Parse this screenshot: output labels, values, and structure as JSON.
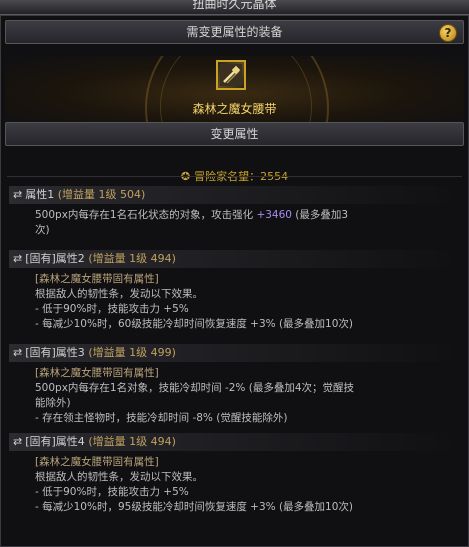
{
  "window_title": "扭曲时久元晶体",
  "header": {
    "equip_section": "需变更属性的装备",
    "help_icon": "?",
    "change_section": "变更属性"
  },
  "item": {
    "name": "森林之魔女腰带",
    "icon": "belt-item-icon"
  },
  "fame": {
    "label": "冒险家名望：",
    "value": "2554"
  },
  "attributes": [
    {
      "title": "属性1",
      "level": "(增益量 1级 504)",
      "lines": [
        {
          "text": "500px内每存在1名石化状态的对象，攻击强化 ",
          "highlight": "+3460",
          "tail": " (最多叠加3"
        },
        {
          "text": "次)"
        }
      ]
    },
    {
      "title": "[固有]属性2",
      "level": "(增益量 1级 494)",
      "lines": [
        {
          "text": "[森林之魔女腰带固有属性]"
        },
        {
          "text": "根据敌人的韧性条，发动以下效果。"
        },
        {
          "text": "- 低于90%时，技能攻击力 +5%"
        },
        {
          "text": "- 每减少10%时，60级技能冷却时间恢复速度 +3% (最多叠加10次)"
        }
      ]
    },
    {
      "title": "[固有]属性3",
      "level": "(增益量 1级 499)",
      "lines": [
        {
          "text": "[森林之魔女腰带固有属性]"
        },
        {
          "text": "500px内每存在1名对象，技能冷却时间 -2% (最多叠加4次；觉醒技"
        },
        {
          "text": "能除外)"
        },
        {
          "text": "- 存在领主怪物时，技能冷却时间 -8% (觉醒技能除外)"
        }
      ]
    },
    {
      "title": "[固有]属性4",
      "level": "(增益量 1级 494)",
      "lines": [
        {
          "text": "[森林之魔女腰带固有属性]"
        },
        {
          "text": "根据敌人的韧性条，发动以下效果。"
        },
        {
          "text": "- 低于90%时，技能攻击力 +5%"
        },
        {
          "text": "- 每减少10%时，95级技能冷却时间恢复速度 +3% (最多叠加10次)"
        }
      ]
    }
  ],
  "colors": {
    "item_name": "#f3d36a",
    "highlight": "#a88cf0",
    "gold": "#c9a227"
  }
}
